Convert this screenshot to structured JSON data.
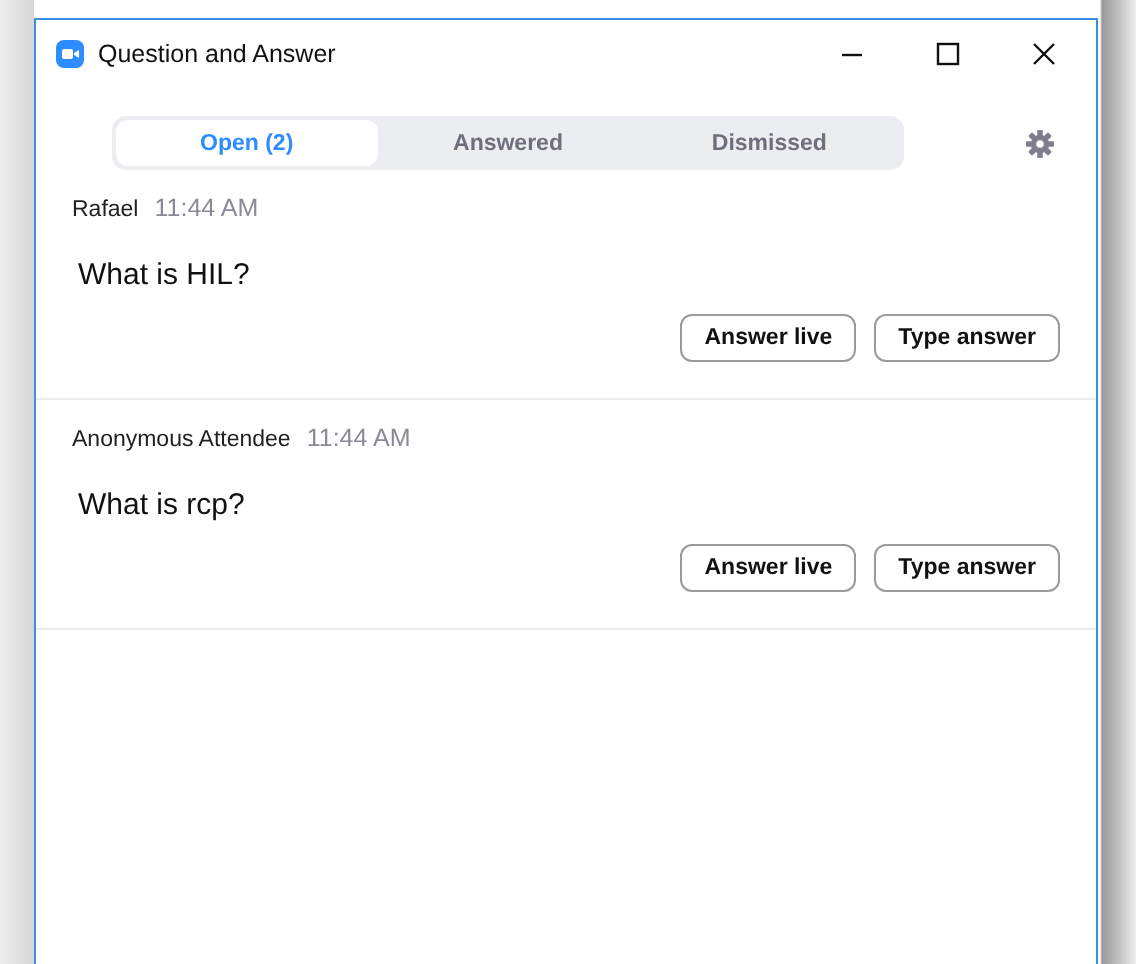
{
  "window": {
    "title": "Question and Answer"
  },
  "tabs": [
    {
      "label": "Open (2)",
      "selected": true
    },
    {
      "label": "Answered",
      "selected": false
    },
    {
      "label": "Dismissed",
      "selected": false
    }
  ],
  "questions": [
    {
      "author": "Rafael",
      "time": "11:44 AM",
      "text": "What is HIL?",
      "buttons": [
        "Answer live",
        "Type answer"
      ]
    },
    {
      "author": "Anonymous Attendee",
      "time": "11:44 AM",
      "text": "What is rcp?",
      "buttons": [
        "Answer live",
        "Type answer"
      ]
    }
  ]
}
